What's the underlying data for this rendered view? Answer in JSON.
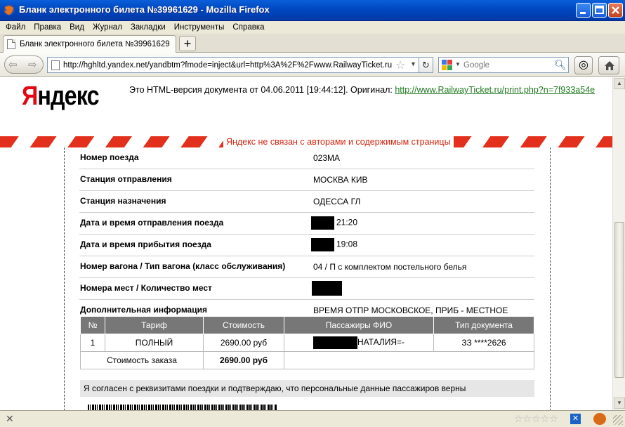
{
  "window": {
    "title": "Бланк электронного билета №39961629 - Mozilla Firefox"
  },
  "menu": [
    "Файл",
    "Правка",
    "Вид",
    "Журнал",
    "Закладки",
    "Инструменты",
    "Справка"
  ],
  "tabs": [
    {
      "label": "Бланк электронного билета №39961629"
    }
  ],
  "nav": {
    "url": "http://hghltd.yandex.net/yandbtm?fmode=inject&url=http%3A%2F%2Fwww.RailwayTicket.ru",
    "search_placeholder": "Google"
  },
  "yandex": {
    "logo_red": "Я",
    "logo_rest": "ндекс",
    "info_prefix": "Это HTML-версия документа от 04.06.2011 [19:44:12].  Оригинал:",
    "original_link": "http://www.RailwayTicket.ru/print.php?n=7f933a54e",
    "disclaimer": "Яндекс не связан с авторами и содержимым страницы"
  },
  "ticket": {
    "rows": [
      {
        "label": "Номер поезда",
        "value": "023МА"
      },
      {
        "label": "Станция отправления",
        "value": "МОСКВА КИВ"
      },
      {
        "label": "Станция назначения",
        "value": "ОДЕССА ГЛ"
      },
      {
        "label": "Дата и время отправления поезда",
        "value": "21:20"
      },
      {
        "label": "Дата и время прибытия поезда",
        "value": "19:08"
      },
      {
        "label": "Номер вагона / Тип вагона (класс обслуживания)",
        "value": "04 / П с комплектом постельного белья"
      },
      {
        "label": "Номера мест / Количество мест",
        "value": ""
      },
      {
        "label": "Дополнительная информация",
        "value": "ВРЕМЯ ОТПР МОСКОВСКОЕ, ПРИБ - МЕСТНОЕ"
      }
    ],
    "table": {
      "headers": [
        "№",
        "Тариф",
        "Стоимость",
        "Пассажиры ФИО",
        "Тип документа"
      ],
      "row": {
        "num": "1",
        "tariff": "ПОЛНЫЙ",
        "cost": "2690.00 руб",
        "name": "НАТАЛИЯ=-",
        "doc": "ЗЗ ****2626"
      },
      "total_label": "Стоимость заказа",
      "total_value": "2690.00 руб"
    },
    "agreement": "Я согласен с реквизитами поездки и подтверждаю, что персональные данные пассажиров верны"
  }
}
